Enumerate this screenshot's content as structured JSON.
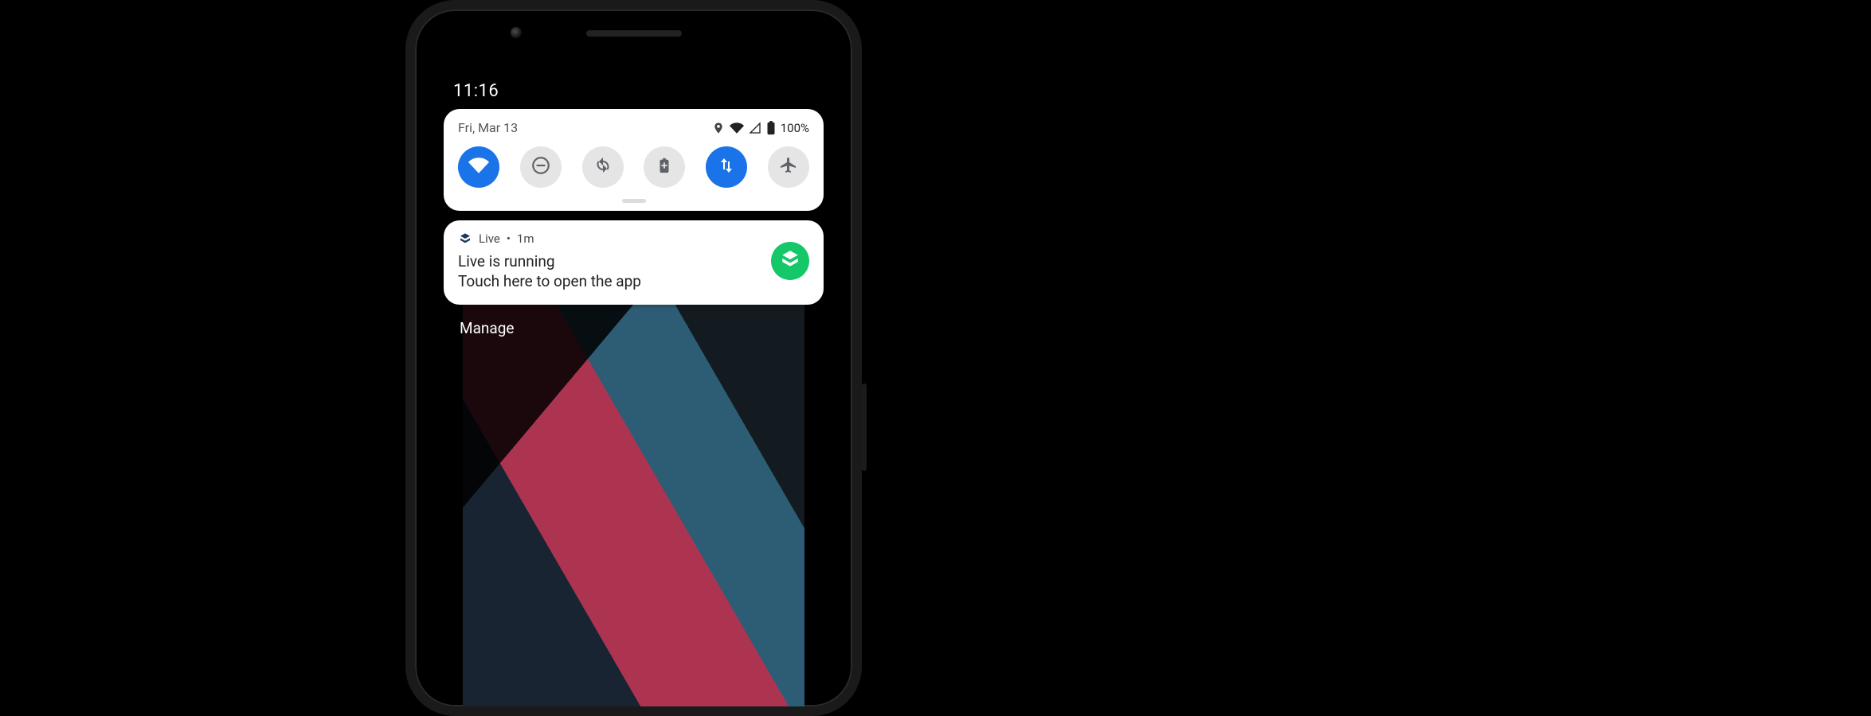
{
  "statusbar": {
    "time": "11:16"
  },
  "quick_settings": {
    "date": "Fri, Mar 13",
    "battery_text": "100%",
    "status_icons": {
      "location": "location-icon",
      "wifi": "wifi-full-icon",
      "cell": "cell-signal-icon",
      "battery": "battery-full-icon"
    },
    "tiles": [
      {
        "id": "wifi",
        "icon": "wifi-icon",
        "on": true
      },
      {
        "id": "do-not-disturb",
        "icon": "do-not-disturb-icon",
        "on": false
      },
      {
        "id": "auto-rotate",
        "icon": "auto-rotate-icon",
        "on": false
      },
      {
        "id": "battery-saver",
        "icon": "battery-saver-icon",
        "on": false
      },
      {
        "id": "mobile-data",
        "icon": "mobile-data-icon",
        "on": true
      },
      {
        "id": "airplane",
        "icon": "airplane-mode-icon",
        "on": false
      }
    ]
  },
  "notifications": [
    {
      "app_name": "Live",
      "separator": "•",
      "age": "1m",
      "title": "Live is running",
      "body": "Touch here to open the app",
      "chip_icon": "stack-cube-icon"
    }
  ],
  "footer": {
    "manage_label": "Manage"
  }
}
